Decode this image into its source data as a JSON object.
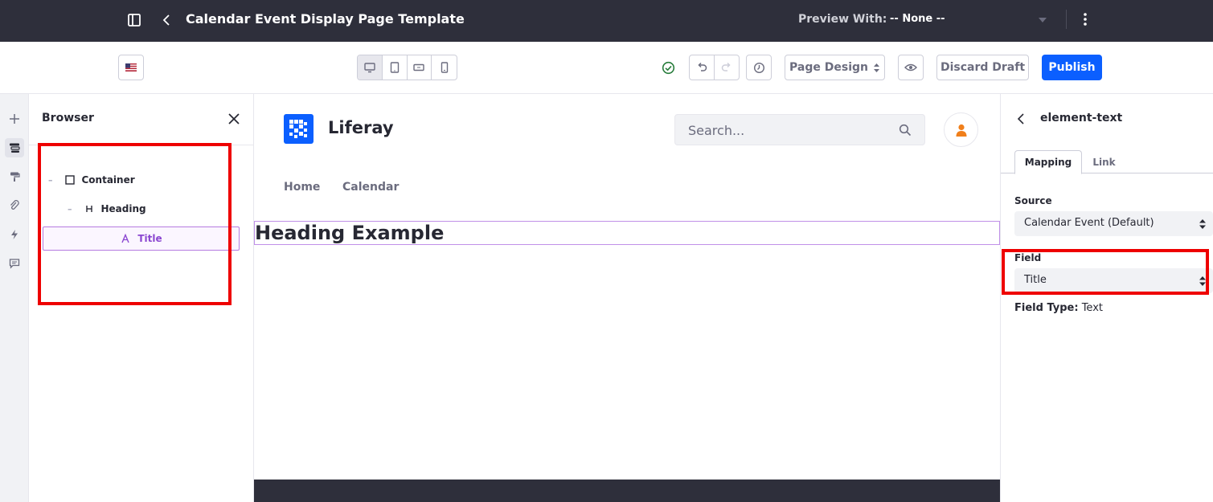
{
  "topbar": {
    "title": "Calendar Event Display Page Template",
    "preview_label": "Preview With:",
    "preview_value": "-- None --"
  },
  "toolbar": {
    "page_design_label": "Page Design",
    "discard_label": "Discard Draft",
    "publish_label": "Publish",
    "status": "saved",
    "accent": "#0b5fff",
    "devices": [
      "desktop",
      "tablet",
      "landscape-phone",
      "portrait-phone"
    ],
    "active_device": "desktop"
  },
  "rail": {
    "items": [
      "add",
      "browser",
      "page-design",
      "mapping",
      "interactions",
      "comments"
    ],
    "active": "browser"
  },
  "browser": {
    "title": "Browser",
    "tree": [
      {
        "label": "Container",
        "icon": "square-icon",
        "level": 0
      },
      {
        "label": "Heading",
        "icon": "heading-icon",
        "level": 1
      },
      {
        "label": "Title",
        "icon": "text-icon",
        "level": 2,
        "selected": true
      }
    ]
  },
  "canvas": {
    "brand": "Liferay",
    "search_placeholder": "Search...",
    "nav": [
      "Home",
      "Calendar"
    ],
    "heading": "Heading Example"
  },
  "sidepanel": {
    "title": "element-text",
    "tabs": [
      "Mapping",
      "Link"
    ],
    "active_tab": "Mapping",
    "source_label": "Source",
    "source_value": "Calendar Event (Default)",
    "field_label": "Field",
    "field_value": "Title",
    "field_type_label": "Field Type:",
    "field_type_value": "Text"
  }
}
